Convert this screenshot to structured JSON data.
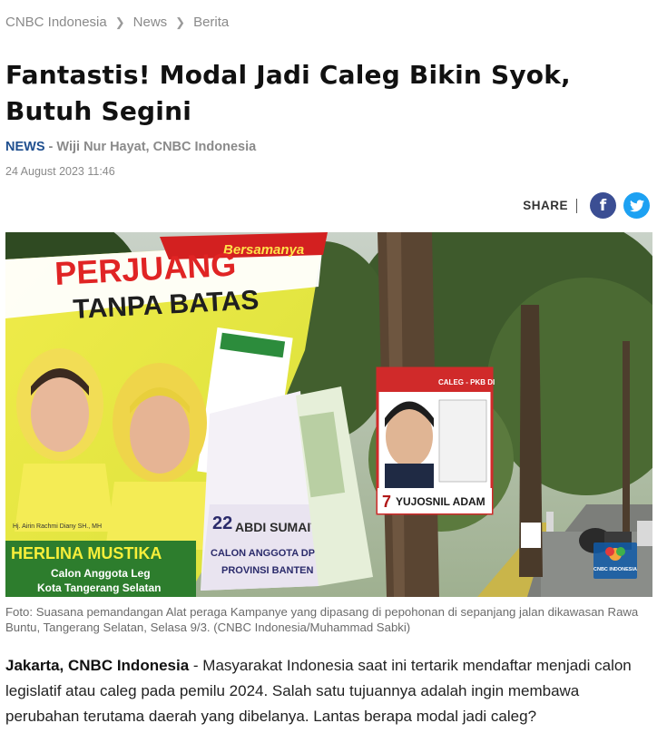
{
  "breadcrumb": {
    "items": [
      "CNBC Indonesia",
      "News",
      "Berita"
    ]
  },
  "article": {
    "title": "Fantastis! Modal Jadi Caleg Bikin Syok, Butuh Segini",
    "category": "NEWS",
    "byline_sep": " - ",
    "author": "Wiji Nur Hayat, CNBC Indonesia",
    "date": "24 August 2023 11:46"
  },
  "share": {
    "label": "SHARE",
    "facebook_icon": "f",
    "twitter_icon": "twitter-bird"
  },
  "photo": {
    "banner_top": "PERJUANG",
    "banner_sub": "TANPA BATAS",
    "banner_curve": "Bersamanya",
    "poster_name_1": "HERLINA MUSTIKA",
    "poster_role_1": "Calon Anggota Leg",
    "poster_region_1": "Kota Tangerang Selatan",
    "poster_small_1": "Hj. Airin Rachmi Diany SH., MH",
    "poster_num_2": "22",
    "poster_name_2": "ABDI SUMAITHI",
    "poster_role_2": "CALON ANGGOTA DPD",
    "poster_region_2": "PROVINSI BANTEN",
    "poster_num_3": "7",
    "poster_name_3": "YUJOSNIL ADAM",
    "poster_label_3": "CALEG - PKB DI",
    "watermark": "CNBC INDONESIA"
  },
  "caption": "Foto: Suasana pemandangan Alat peraga Kampanye yang dipasang di pepohonan di sepanjang jalan dikawasan Rawa Buntu, Tangerang Selatan, Selasa 9/3. (CNBC Indonesia/Muhammad Sabki)",
  "body": {
    "dateline": "Jakarta, CNBC Indonesia",
    "text": " - Masyarakat Indonesia saat ini tertarik mendaftar menjadi calon legislatif atau caleg pada pemilu 2024. Salah satu tujuannya adalah ingin membawa perubahan terutama daerah yang dibelanya. Lantas berapa modal jadi caleg?"
  },
  "colors": {
    "category": "#1f4f8f",
    "facebook": "#3b4e93",
    "twitter": "#1da1f2",
    "muted": "#8a8a8a"
  }
}
